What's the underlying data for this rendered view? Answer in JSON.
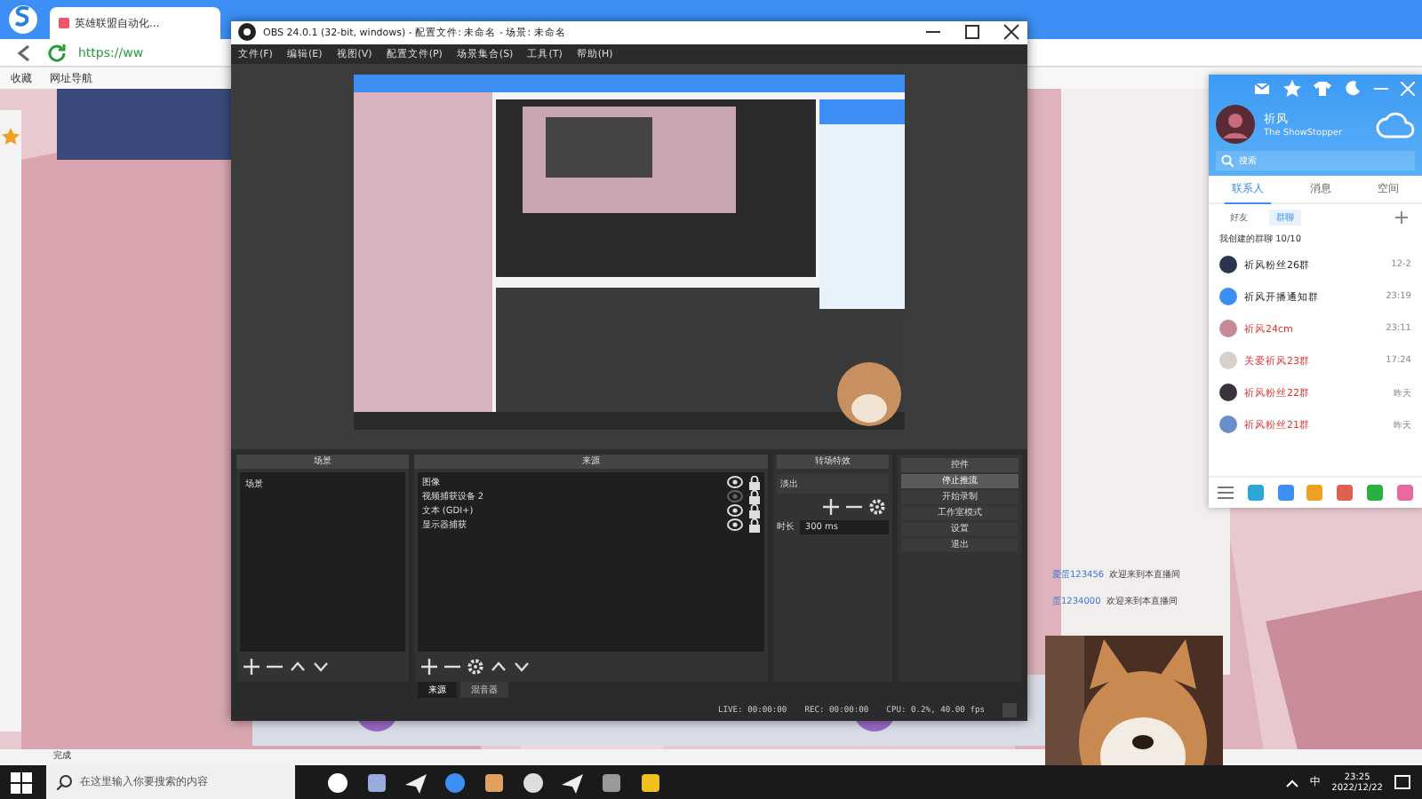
{
  "browser": {
    "tab_title": "英雄联盟自动化...",
    "url": "https://ww",
    "bookmarks": [
      "收藏",
      "网址导航"
    ],
    "status": "完成",
    "chat": [
      {
        "name": "爱蛋123456",
        "text": "欢迎来到本直播间"
      },
      {
        "name": "蛋1234000",
        "text": "欢迎来到本直播间"
      }
    ]
  },
  "obs": {
    "title": "OBS 24.0.1 (32-bit, windows) - 配置文件: 未命名 - 场景: 未命名",
    "menu": [
      "文件(F)",
      "编辑(E)",
      "视图(V)",
      "配置文件(P)",
      "场景集合(S)",
      "工具(T)",
      "帮助(H)"
    ],
    "scenes": {
      "title": "场景",
      "items": [
        {
          "label": "场景",
          "selected": false
        }
      ]
    },
    "sources": {
      "title": "来源",
      "items": [
        {
          "label": "图像",
          "visible": true,
          "locked": true
        },
        {
          "label": "视频捕获设备 2",
          "visible": false,
          "locked": true
        },
        {
          "label": "文本 (GDI+)",
          "visible": true,
          "locked": true
        },
        {
          "label": "显示器捕获",
          "visible": true,
          "locked": true
        }
      ],
      "tabs": [
        {
          "label": "来源",
          "selected": true
        },
        {
          "label": "混音器",
          "selected": false
        }
      ]
    },
    "transitions": {
      "title": "转场特效",
      "select": "淡出",
      "duration_label": "时长",
      "duration": "300 ms"
    },
    "controls": {
      "title": "控件",
      "buttons": [
        {
          "label": "停止推流",
          "active": true
        },
        {
          "label": "开始录制",
          "active": false
        },
        {
          "label": "工作室模式",
          "active": false
        },
        {
          "label": "设置",
          "active": false
        },
        {
          "label": "退出",
          "active": false
        }
      ]
    },
    "status": [
      "LIVE: 00:00:00",
      "REC: 00:00:00",
      "CPU: 0.2%, 40.00 fps"
    ]
  },
  "qq": {
    "name": "祈风",
    "signature": "The ShowStopper",
    "search_placeholder": "搜索",
    "tabs": [
      {
        "label": "联系人",
        "selected": true
      },
      {
        "label": "消息",
        "selected": false
      },
      {
        "label": "空间",
        "selected": false
      }
    ],
    "subtabs": [
      {
        "label": "好友",
        "selected": false
      },
      {
        "label": "群聊",
        "selected": true
      }
    ],
    "group_header": "我创建的群聊 10/10",
    "groups": [
      {
        "name": "祈风粉丝26群",
        "time": "12-2",
        "highlight": false
      },
      {
        "name": "祈风开播通知群",
        "time": "23:19",
        "highlight": false
      },
      {
        "name": "祈风24cm",
        "time": "23:11",
        "highlight": true
      },
      {
        "name": "关爱祈风23群",
        "time": "17:24",
        "highlight": true
      },
      {
        "name": "祈风粉丝22群",
        "time": "昨天",
        "highlight": true
      },
      {
        "name": "祈风粉丝21群",
        "time": "昨天",
        "highlight": true
      }
    ]
  },
  "taskbar": {
    "search_placeholder": "在这里输入你要搜索的内容",
    "ime": "中",
    "time": "23:25",
    "date": "2022/12/22"
  }
}
